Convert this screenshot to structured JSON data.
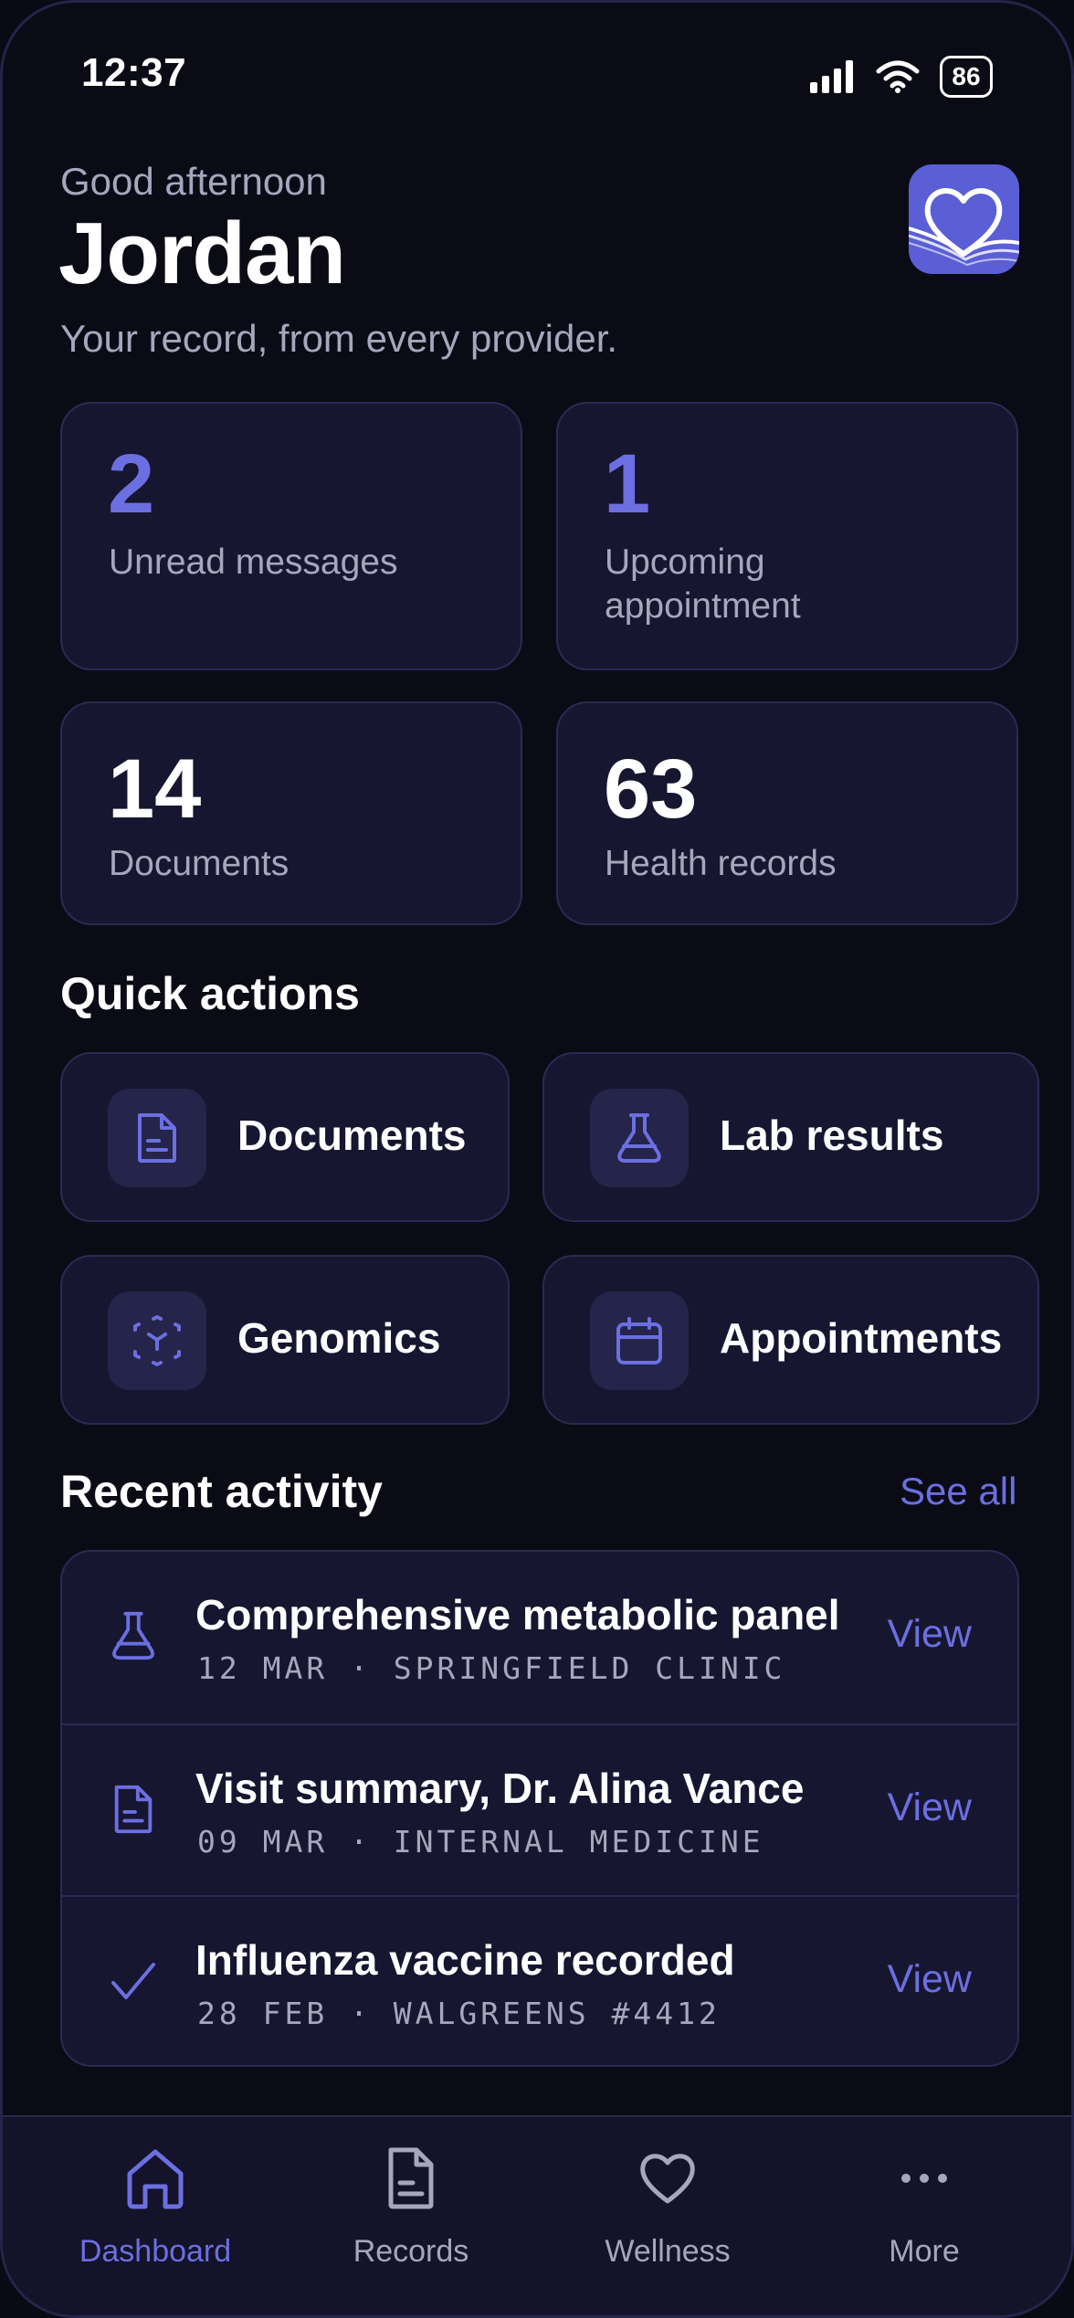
{
  "status_bar": {
    "time": "12:37",
    "battery": "86"
  },
  "header": {
    "greeting": "Good afternoon",
    "name": "Jordan",
    "subtitle": "Your record, from every provider."
  },
  "stats": [
    {
      "value": "2",
      "label": "Unread messages"
    },
    {
      "value": "1",
      "label": "Upcoming appointment"
    },
    {
      "value": "14",
      "label": "Documents"
    },
    {
      "value": "63",
      "label": "Health records"
    }
  ],
  "quick_actions": {
    "title": "Quick actions",
    "items": [
      {
        "label": "Documents",
        "icon": "document-icon"
      },
      {
        "label": "Lab results",
        "icon": "flask-icon"
      },
      {
        "label": "Genomics",
        "icon": "genomics-icon"
      },
      {
        "label": "Appointments",
        "icon": "calendar-icon"
      }
    ]
  },
  "recent_activity": {
    "title": "Recent activity",
    "see_all": "See all",
    "items": [
      {
        "title": "Comprehensive metabolic panel",
        "meta": "12 MAR · SPRINGFIELD CLINIC",
        "action": "View",
        "icon": "flask-icon"
      },
      {
        "title": "Visit summary, Dr. Alina Vance",
        "meta": "09 MAR · INTERNAL MEDICINE",
        "action": "View",
        "icon": "document-icon"
      },
      {
        "title": "Influenza vaccine recorded",
        "meta": "28 FEB · WALGREENS #4412",
        "action": "View",
        "icon": "check-icon"
      }
    ]
  },
  "nav": {
    "items": [
      {
        "label": "Dashboard",
        "icon": "home-icon",
        "active": true
      },
      {
        "label": "Records",
        "icon": "document-icon"
      },
      {
        "label": "Wellness",
        "icon": "heart-icon"
      },
      {
        "label": "More",
        "icon": "more-icon"
      }
    ]
  },
  "colors": {
    "accent": "#6b6fe0",
    "card": "#171630",
    "background": "#0b0b16",
    "logo": "#5a5fd6"
  }
}
